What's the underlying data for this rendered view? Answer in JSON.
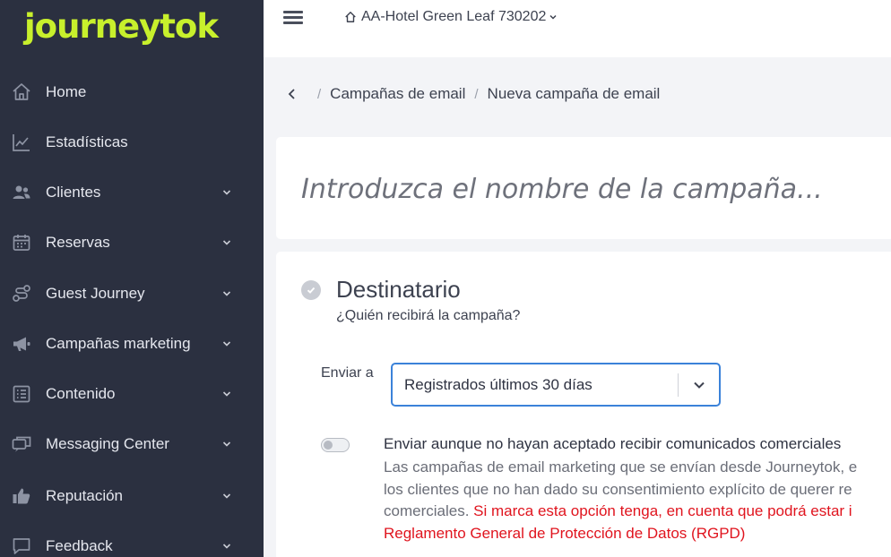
{
  "brand": {
    "logo_text": "journeytok",
    "accent": "#c8f02c"
  },
  "sidebar": {
    "bg": "#2b3040",
    "items": [
      {
        "label": "Home",
        "icon": "home-icon",
        "has_submenu": false
      },
      {
        "label": "Estadísticas",
        "icon": "chart-line-icon",
        "has_submenu": false
      },
      {
        "label": "Clientes",
        "icon": "users-icon",
        "has_submenu": true
      },
      {
        "label": "Reservas",
        "icon": "calendar-icon",
        "has_submenu": true
      },
      {
        "label": "Guest Journey",
        "icon": "route-icon",
        "has_submenu": true
      },
      {
        "label": "Campañas marketing",
        "icon": "megaphone-icon",
        "has_submenu": true
      },
      {
        "label": "Contenido",
        "icon": "list-icon",
        "has_submenu": true
      },
      {
        "label": "Messaging Center",
        "icon": "chat-icon",
        "has_submenu": true
      },
      {
        "label": "Reputación",
        "icon": "thumbs-up-icon",
        "has_submenu": true
      },
      {
        "label": "Feedback",
        "icon": "message-square-icon",
        "has_submenu": true
      }
    ]
  },
  "topbar": {
    "hotel_selector": "AA-Hotel Green Leaf 730202"
  },
  "breadcrumb": {
    "items": [
      "Campañas de email",
      "Nueva campaña de email"
    ]
  },
  "campaign": {
    "name_placeholder": "Introduzca el nombre de la campaña..."
  },
  "recipient": {
    "title": "Destinatario",
    "subtitle": "¿Quién recibirá la campaña?",
    "send_to_label": "Enviar a",
    "send_to_value": "Registrados últimos 30 días",
    "consent_toggle_on": false,
    "consent_title": "Enviar aunque no hayan aceptado recibir comunicados comerciales",
    "consent_desc_line1": "Las campañas de email marketing que se envían desde Journeytok, e",
    "consent_desc_line2": "los clientes que no han dado su consentimiento explícito de querer re",
    "consent_desc_line3": "comerciales.",
    "consent_warning_line3": " Si marca esta opción tenga, en cuenta que podrá estar i",
    "consent_warning_line4": "Reglamento General de Protección de Datos (RGPD)",
    "warning_color": "#e0141e"
  }
}
